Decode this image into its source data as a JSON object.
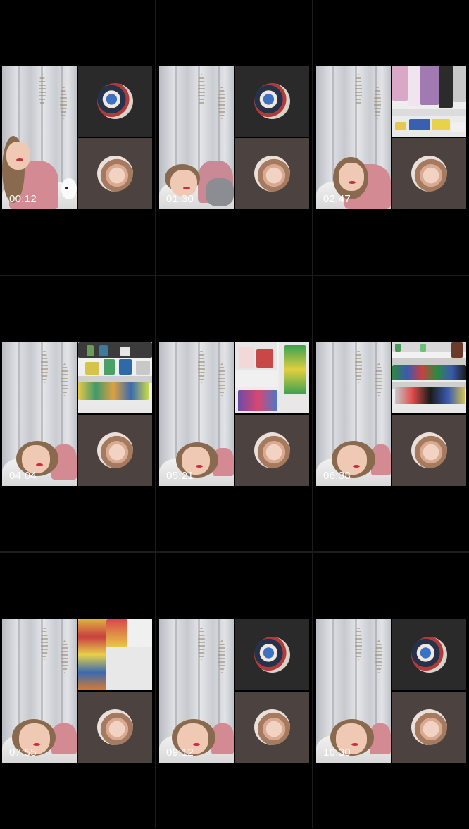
{
  "thumbnails": [
    {
      "timestamp": "00:12",
      "top_tile": "avatar-group",
      "bottom_tile": "avatar-selfie"
    },
    {
      "timestamp": "01:30",
      "top_tile": "avatar-group",
      "bottom_tile": "avatar-selfie"
    },
    {
      "timestamp": "02:47",
      "top_tile": "store-cosmetics",
      "bottom_tile": "avatar-selfie"
    },
    {
      "timestamp": "04:04",
      "top_tile": "store-shelf",
      "bottom_tile": "avatar-selfie"
    },
    {
      "timestamp": "05:21",
      "top_tile": "store-aisle",
      "bottom_tile": "avatar-selfie"
    },
    {
      "timestamp": "06:38",
      "top_tile": "store-drinks",
      "bottom_tile": "avatar-selfie"
    },
    {
      "timestamp": "07:55",
      "top_tile": "store-snacks",
      "bottom_tile": "avatar-selfie"
    },
    {
      "timestamp": "09:12",
      "top_tile": "avatar-group",
      "bottom_tile": "avatar-selfie"
    },
    {
      "timestamp": "10:30",
      "top_tile": "avatar-group",
      "bottom_tile": "avatar-selfie"
    }
  ],
  "colors": {
    "background": "#000000",
    "divider": "#1c1c1c",
    "timestamp": "#ffffff",
    "tile_dark": "#2a2a2a",
    "tile_brown": "#4c4240"
  }
}
